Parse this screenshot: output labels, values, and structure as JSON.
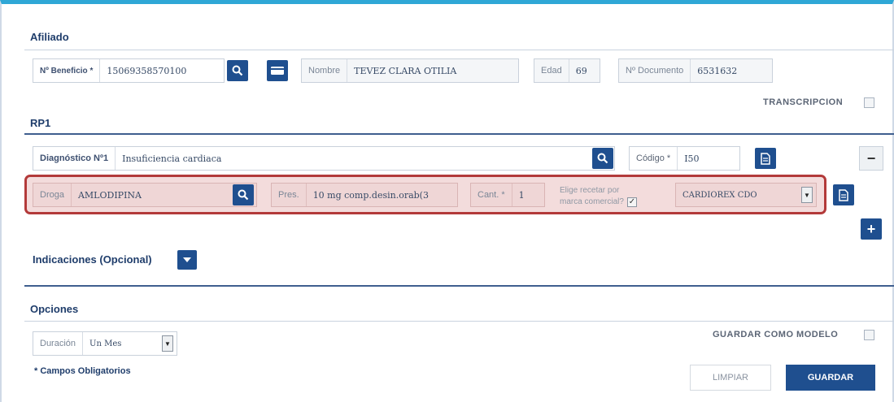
{
  "afiliado": {
    "title": "Afiliado",
    "beneficio_label": "Nº Beneficio *",
    "beneficio_value": "15069358570100",
    "nombre_label": "Nombre",
    "nombre_value": "TEVEZ CLARA OTILIA",
    "edad_label": "Edad",
    "edad_value": "69",
    "documento_label": "Nº Documento",
    "documento_value": "6531632",
    "transcripcion_label": "TRANSCRIPCION"
  },
  "rp1": {
    "title": "RP1",
    "diagnostico_label": "Diagnóstico Nº1",
    "diagnostico_value": "Insuficiencia cardiaca",
    "codigo_label": "Código *",
    "codigo_value": "I50",
    "droga_label": "Droga",
    "droga_value": "AMLODIPINA",
    "pres_label": "Pres.",
    "pres_value": "10 mg comp.desin.orab(3",
    "cant_label": "Cant. *",
    "cant_value": "1",
    "marca_label_1": "Elige recetar por",
    "marca_label_2": "marca comercial?",
    "marca_select": "CARDIOREX CDO",
    "minus_symbol": "−",
    "plus_symbol": "+"
  },
  "indicaciones": {
    "title": "Indicaciones (Opcional)"
  },
  "opciones": {
    "title": "Opciones",
    "duracion_label": "Duración",
    "duracion_value": "Un Mes",
    "guardar_modelo_label": "GUARDAR COMO MODELO",
    "obligatorios": "* Campos Obligatorios",
    "limpiar": "LIMPIAR",
    "guardar": "GUARDAR"
  },
  "colors": {
    "accent": "#1f4f8f",
    "top_bar": "#2fa7d6",
    "highlight": "#b33a3a"
  }
}
